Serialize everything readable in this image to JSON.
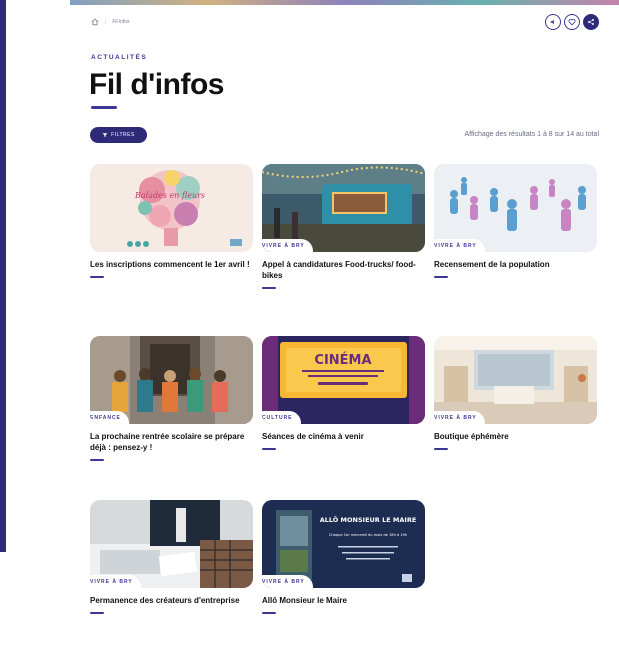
{
  "breadcrumb": {
    "current": "Fil infos"
  },
  "header": {
    "kicker": "ACTUALITÉS",
    "title": "Fil d'infos"
  },
  "toolbar": {
    "filter_label": "FILTRES",
    "results_text": "Affichage des résultats 1 à 8 sur 14 au total"
  },
  "icons": {
    "home": "home-icon",
    "filter": "filter-icon",
    "listen": "listen-icon",
    "favorite": "heart-icon",
    "share": "share-icon"
  },
  "colors": {
    "primary": "#2e2a78",
    "accent": "#3b3796"
  },
  "cards": [
    {
      "tag": "",
      "title": "Les inscriptions commencent le 1er avril !",
      "poster_text": "Balades en fleurs"
    },
    {
      "tag": "VIVRE À BRY",
      "title": "Appel à candidatures Food-trucks/ food-bikes"
    },
    {
      "tag": "VIVRE À BRY",
      "title": "Recensement de la population"
    },
    {
      "tag": "ENFANCE",
      "title": "La prochaine rentrée scolaire se prépare déjà : pensez-y !"
    },
    {
      "tag": "CULTURE",
      "title": "Séances de cinéma à venir",
      "poster_text": "CINÉMA"
    },
    {
      "tag": "VIVRE À BRY",
      "title": "Boutique éphémère"
    },
    {
      "tag": "VIVRE À BRY",
      "title": "Permanence des créateurs d'entreprise"
    },
    {
      "tag": "VIVRE À BRY",
      "title": "Allô Monsieur le Maire",
      "poster_text": "ALLÔ MONSIEUR LE MAIRE",
      "poster_subtext": "Chaque 1er mercredi du mois de 18h à 19h"
    }
  ]
}
